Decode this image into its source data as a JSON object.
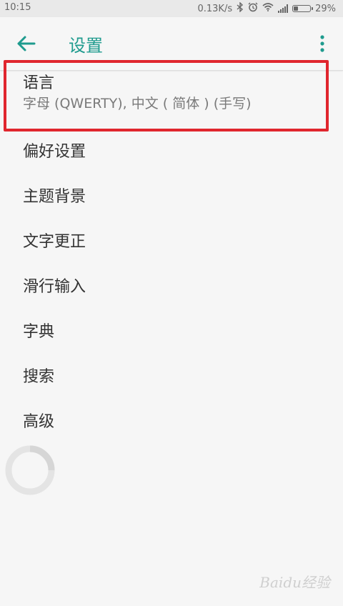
{
  "status_bar": {
    "time": "10:15",
    "speed": "0.13K/s",
    "battery_percent": "29%",
    "battery_level": 0.29,
    "icons": [
      "bluetooth-icon",
      "alarm-icon",
      "wifi-icon",
      "signal-icon",
      "battery-icon"
    ]
  },
  "app_bar": {
    "title": "设置",
    "back_icon": "arrow-left-icon",
    "more_icon": "more-vert-icon",
    "accent_color": "#1f9b8e"
  },
  "settings": {
    "items": [
      {
        "title": "语言",
        "subtitle": "字母 (QWERTY), 中文 ( 简体 ) (手写)"
      },
      {
        "title": "偏好设置"
      },
      {
        "title": "主题背景"
      },
      {
        "title": "文字更正"
      },
      {
        "title": "滑行输入"
      },
      {
        "title": "字典"
      },
      {
        "title": "搜索"
      },
      {
        "title": "高级"
      }
    ]
  },
  "highlight": {
    "color": "#e0262e"
  },
  "watermark": {
    "text": "Baidu经验"
  }
}
